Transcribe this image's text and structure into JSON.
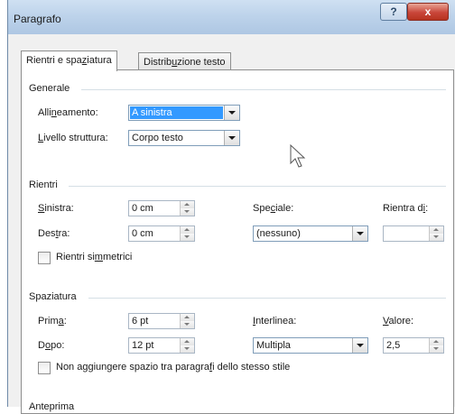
{
  "window": {
    "title": "Paragrafo"
  },
  "title_buttons": {
    "help": "?",
    "close": "x"
  },
  "tabs": [
    {
      "label_pre": "Rientri e spa",
      "label_u": "z",
      "label_post": "iatura",
      "active": true
    },
    {
      "label_pre": "Distrib",
      "label_u": "u",
      "label_post": "zione testo",
      "active": false
    }
  ],
  "generale": {
    "title": "Generale",
    "alignment": {
      "label_pre": "Alli",
      "label_u": "n",
      "label_post": "eamento:",
      "value": "A sinistra"
    },
    "outline": {
      "label_pre": "",
      "label_u": "L",
      "label_post": "ivello struttura:",
      "value": "Corpo testo"
    }
  },
  "rientri": {
    "title": "Rientri",
    "left": {
      "label_pre": "",
      "label_u": "S",
      "label_post": "inistra:",
      "value": "0 cm"
    },
    "right": {
      "label_pre": "Des",
      "label_u": "t",
      "label_post": "ra:",
      "value": "0 cm"
    },
    "special": {
      "label_pre": "Spe",
      "label_u": "c",
      "label_post": "iale:",
      "value": "(nessuno)"
    },
    "by": {
      "label_pre": "Rientra d",
      "label_u": "i",
      "label_post": ":",
      "value": ""
    },
    "mirror": {
      "label_pre": "Rientri si",
      "label_u": "m",
      "label_post": "metrici",
      "checked": false
    }
  },
  "spaziatura": {
    "title": "Spaziatura",
    "before": {
      "label_pre": "Prim",
      "label_u": "a",
      "label_post": ":",
      "value": "6 pt"
    },
    "after": {
      "label_pre": "D",
      "label_u": "o",
      "label_post": "po:",
      "value": "12 pt"
    },
    "line_spacing": {
      "label_pre": "",
      "label_u": "I",
      "label_post": "nterlinea:",
      "value": "Multipla"
    },
    "at": {
      "label_pre": "",
      "label_u": "V",
      "label_post": "alore:",
      "value": "2,5"
    },
    "no_space": {
      "label_pre": "Non aggiungere spazio tra paragra",
      "label_u": "f",
      "label_post": "i dello stesso stile",
      "checked": false
    }
  },
  "anteprima": {
    "title": "Anteprima"
  },
  "colors": {
    "selection": "#3399ff",
    "close_button": "#c9463a",
    "titlebar": "#bcd2ea"
  }
}
